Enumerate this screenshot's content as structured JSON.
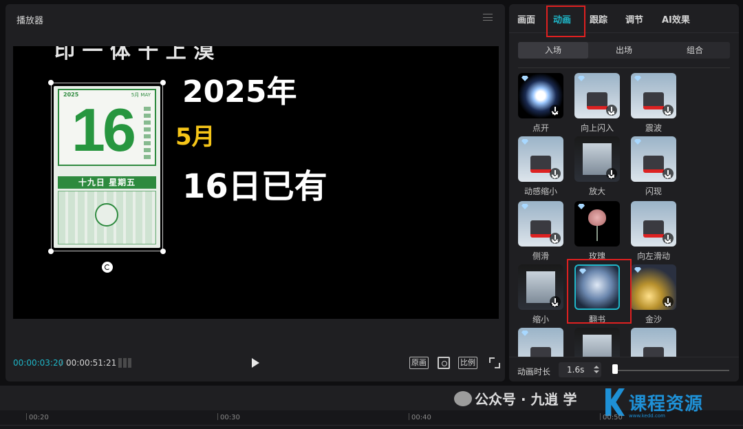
{
  "player": {
    "title": "播放器",
    "canvas_text": {
      "year": "2025年",
      "month": "5月",
      "day_line": "16日已有",
      "partial_top": "印 一 体 干 上 漠"
    },
    "calendar": {
      "year": "2025",
      "month_label": "5月 MAY",
      "day_number": "16",
      "bar_text": "十九日 星期五"
    },
    "time_current": "00:00:03:20",
    "time_separator": "/",
    "time_total": "00:00:51:21",
    "buttons": {
      "original": "原画",
      "ratio": "比例"
    }
  },
  "right_panel": {
    "tabs": [
      "画面",
      "动画",
      "跟踪",
      "调节",
      "AI效果"
    ],
    "active_tab": "动画",
    "subtabs": [
      "入场",
      "出场",
      "组合"
    ],
    "active_subtab": "入场",
    "animations": [
      {
        "label": "点开",
        "style": "glow",
        "gem": true,
        "download": true
      },
      {
        "label": "向上闪入",
        "style": "photo",
        "gem": true,
        "download": true
      },
      {
        "label": "震波",
        "style": "photo",
        "gem": true,
        "download": true
      },
      {
        "label": "动感缩小",
        "style": "photo",
        "gem": true,
        "download": true
      },
      {
        "label": "放大",
        "style": "dark",
        "gem": false,
        "download": true
      },
      {
        "label": "闪现",
        "style": "photo",
        "gem": true,
        "download": true
      },
      {
        "label": "侧滑",
        "style": "photo",
        "gem": true,
        "download": true
      },
      {
        "label": "玫瑰",
        "style": "rose",
        "gem": true,
        "download": false
      },
      {
        "label": "向左滑动",
        "style": "photo",
        "gem": false,
        "download": true
      },
      {
        "label": "缩小",
        "style": "dark",
        "gem": false,
        "download": true
      },
      {
        "label": "翻书",
        "style": "book",
        "gem": true,
        "download": false
      },
      {
        "label": "金沙",
        "style": "gold",
        "gem": true,
        "download": true
      },
      {
        "label": "",
        "style": "photo",
        "gem": true,
        "download": false
      },
      {
        "label": "",
        "style": "dark",
        "gem": false,
        "download": false
      },
      {
        "label": "",
        "style": "photo",
        "gem": false,
        "download": false
      }
    ],
    "duration_label": "动画时长",
    "duration_value": "1.6s"
  },
  "timeline": {
    "ticks": [
      "00:20",
      "00:30",
      "00:40",
      "00:50"
    ],
    "watermark": "公众号 · 九逍 学",
    "logo_text": "课程资源",
    "logo_url": "www.kedd.com"
  },
  "colors": {
    "accent": "#1fb7c9",
    "highlight_box": "#e02020",
    "month_yellow": "#f5c518",
    "calendar_green": "#27963f"
  }
}
